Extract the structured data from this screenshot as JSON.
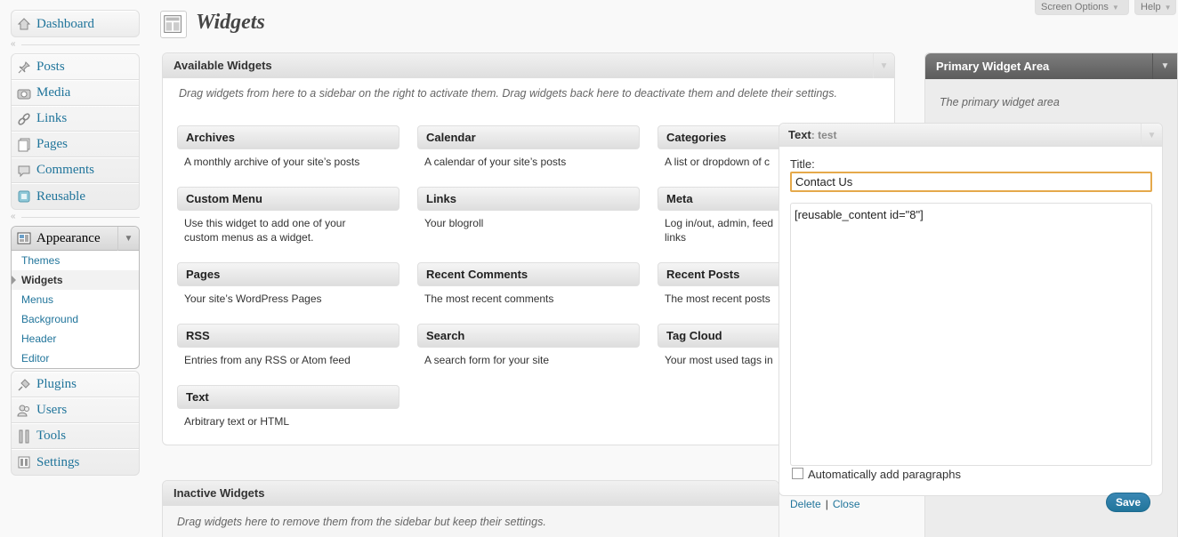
{
  "menu": {
    "dashboard": "Dashboard",
    "group2": [
      "Posts",
      "Media",
      "Links",
      "Pages",
      "Comments",
      "Reusable"
    ],
    "appearance": {
      "label": "Appearance",
      "submenu": [
        "Themes",
        "Widgets",
        "Menus",
        "Background",
        "Header",
        "Editor"
      ],
      "current": "Widgets"
    },
    "group4": [
      "Plugins",
      "Users",
      "Tools",
      "Settings"
    ]
  },
  "header": {
    "title": "Widgets",
    "screen_options": "Screen Options",
    "help": "Help"
  },
  "available": {
    "title": "Available Widgets",
    "description": "Drag widgets from here to a sidebar on the right to activate them. Drag widgets back here to deactivate them and delete their settings.",
    "widgets": [
      {
        "name": "Archives",
        "desc": "A monthly archive of your site’s posts"
      },
      {
        "name": "Calendar",
        "desc": "A calendar of your site’s posts"
      },
      {
        "name": "Categories",
        "desc": "A list or dropdown of c"
      },
      {
        "name": "Custom Menu",
        "desc": "Use this widget to add one of your custom menus as a widget."
      },
      {
        "name": "Links",
        "desc": "Your blogroll"
      },
      {
        "name": "Meta",
        "desc": "Log in/out, admin, feed links"
      },
      {
        "name": "Pages",
        "desc": "Your site’s WordPress Pages"
      },
      {
        "name": "Recent Comments",
        "desc": "The most recent comments"
      },
      {
        "name": "Recent Posts",
        "desc": "The most recent posts"
      },
      {
        "name": "RSS",
        "desc": "Entries from any RSS or Atom feed"
      },
      {
        "name": "Search",
        "desc": "A search form for your site"
      },
      {
        "name": "Tag Cloud",
        "desc": "Your most used tags in"
      },
      {
        "name": "Text",
        "desc": "Arbitrary text or HTML"
      }
    ]
  },
  "inactive": {
    "title": "Inactive Widgets",
    "description": "Drag widgets here to remove them from the sidebar but keep their settings."
  },
  "sidebar": {
    "title": "Primary Widget Area",
    "description": "The primary widget area"
  },
  "text_widget": {
    "name": "Text",
    "instance": ": test",
    "title_label": "Title:",
    "title_value": "Contact Us",
    "content_value": "[reusable_content id=\"8\"]",
    "auto_paragraphs_label": "Automatically add paragraphs",
    "auto_paragraphs_checked": false,
    "delete_label": "Delete",
    "separator": "|",
    "close_label": "Close",
    "save_label": "Save"
  }
}
